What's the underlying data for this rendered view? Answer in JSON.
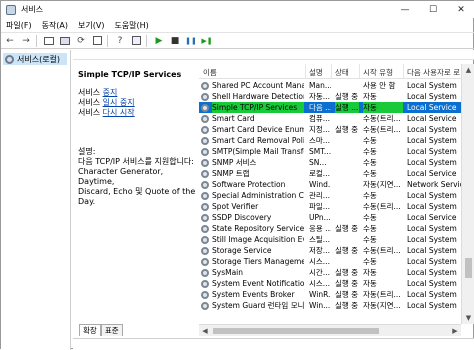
{
  "window": {
    "title": "서비스",
    "minimize": "—",
    "maximize": "☐",
    "close": "✕"
  },
  "menu": [
    "파일(F)",
    "동작(A)",
    "보기(V)",
    "도움말(H)"
  ],
  "toolbar": {
    "back": "←",
    "forward": "→",
    "play": "▶",
    "stop": "■",
    "pause": "❚❚",
    "restart": "▶❚"
  },
  "tree": {
    "label": "서비스(로컬)"
  },
  "header_label": "서비스(로컬)",
  "detail": {
    "service_name": "Simple TCP/IP Services",
    "stop_word": "서비스",
    "stop_link": "중지",
    "pause_word": "서비스",
    "pause_link": "일시 중지",
    "restart_word": "서비스",
    "restart_link": "다시 시작",
    "desc_label": "설명:",
    "desc_text": "다음 TCP/IP 서비스를 지원합니다:\nCharacter Generator, Daytime,\nDiscard, Echo 및 Quote of the Day."
  },
  "columns": [
    "이름",
    "설명",
    "상태",
    "시작 유형",
    "다음 사용자로 로"
  ],
  "rows": [
    {
      "name": "Shared PC Account Manager",
      "desc": "Man...",
      "status": "",
      "startup": "사용 안 함",
      "logon": "Local System"
    },
    {
      "name": "Shell Hardware Detection",
      "desc": "자동...",
      "status": "실행 중",
      "startup": "자동",
      "logon": "Local System"
    },
    {
      "name": "Simple TCP/IP Services",
      "desc": "다음 ...",
      "status": "실행 ...",
      "startup": "자동",
      "logon": "Local Service",
      "selected": true
    },
    {
      "name": "Smart Card",
      "desc": "컴퓨...",
      "status": "",
      "startup": "수동(트리...",
      "logon": "Local Service"
    },
    {
      "name": "Smart Card Device Enumer...",
      "desc": "지정...",
      "status": "실행 중",
      "startup": "수동(트리...",
      "logon": "Local System"
    },
    {
      "name": "Smart Card Removal Policy",
      "desc": "스마...",
      "status": "",
      "startup": "수동",
      "logon": "Local System"
    },
    {
      "name": "SMTP(Simple Mail Transfer...",
      "desc": "SMT...",
      "status": "",
      "startup": "수동",
      "logon": "Local System"
    },
    {
      "name": "SNMP 서비스",
      "desc": "SN...",
      "status": "",
      "startup": "수동",
      "logon": "Local System"
    },
    {
      "name": "SNMP 트랩",
      "desc": "로컬...",
      "status": "",
      "startup": "수동",
      "logon": "Local Service"
    },
    {
      "name": "Software Protection",
      "desc": "Wind...",
      "status": "",
      "startup": "자동(지연...",
      "logon": "Network Service"
    },
    {
      "name": "Special Administration Con...",
      "desc": "관리...",
      "status": "",
      "startup": "수동",
      "logon": "Local System"
    },
    {
      "name": "Spot Verifier",
      "desc": "파일...",
      "status": "",
      "startup": "수동(트리...",
      "logon": "Local System"
    },
    {
      "name": "SSDP Discovery",
      "desc": "UPn...",
      "status": "",
      "startup": "수동",
      "logon": "Local Service"
    },
    {
      "name": "State Repository Service",
      "desc": "응용 ...",
      "status": "실행 중",
      "startup": "수동",
      "logon": "Local System"
    },
    {
      "name": "Still Image Acquisition Eve...",
      "desc": "스틸...",
      "status": "",
      "startup": "수동",
      "logon": "Local System"
    },
    {
      "name": "Storage Service",
      "desc": "저장...",
      "status": "실행 중",
      "startup": "수동(트리...",
      "logon": "Local System"
    },
    {
      "name": "Storage Tiers Management",
      "desc": "시스...",
      "status": "",
      "startup": "수동",
      "logon": "Local System"
    },
    {
      "name": "SysMain",
      "desc": "시간...",
      "status": "실행 중",
      "startup": "자동",
      "logon": "Local System"
    },
    {
      "name": "System Event Notification ...",
      "desc": "시스...",
      "status": "실행 중",
      "startup": "자동",
      "logon": "Local System"
    },
    {
      "name": "System Events Broker",
      "desc": "WinR...",
      "status": "실행 중",
      "startup": "자동(트리...",
      "logon": "Local System"
    },
    {
      "name": "System Guard 런타임 모니...",
      "desc": "Win...",
      "status": "실행 중",
      "startup": "자동(지연...",
      "logon": "Local System"
    }
  ],
  "tabs": [
    "확장",
    "표준"
  ],
  "colors": {
    "selected": "#0b6fd0",
    "highlight": "#18c93a",
    "link": "#0645ad"
  }
}
